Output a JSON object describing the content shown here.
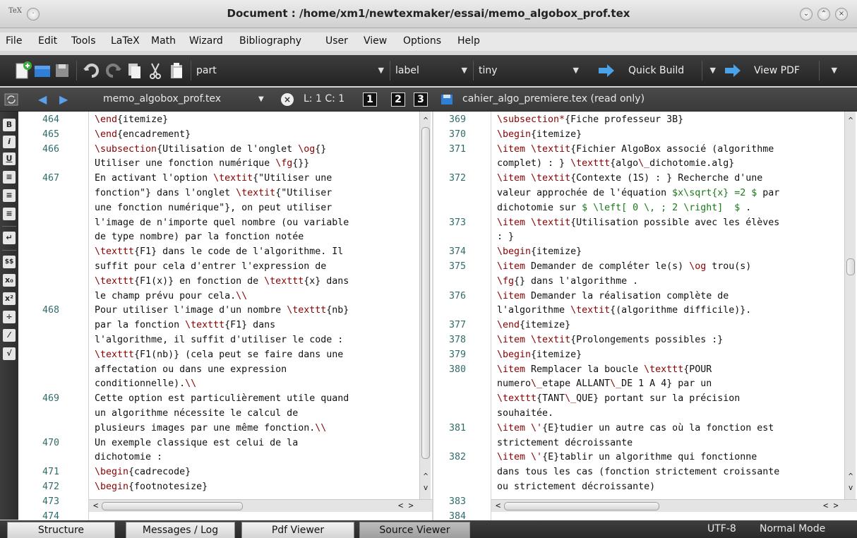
{
  "window": {
    "title": "Document : /home/xm1/newtexmaker/essai/memo_algobox_prof.tex",
    "app_icon": "TeX"
  },
  "menu": [
    "File",
    "Edit",
    "Tools",
    "LaTeX",
    "Math",
    "Wizard",
    "Bibliography",
    "User",
    "View",
    "Options",
    "Help"
  ],
  "toolbar": {
    "combo_part": "part",
    "combo_label": "label",
    "combo_size": "tiny",
    "quick_build": "Quick Build",
    "view_pdf": "View PDF"
  },
  "tabstrip": {
    "left_file": "memo_algobox_prof.tex",
    "cursor": "L: 1 C: 1",
    "views": [
      "1",
      "2",
      "3"
    ],
    "right_file": "cahier_algo_premiere.tex (read only)"
  },
  "left_toolbar": [
    "B",
    "i",
    "U",
    "≡",
    "≡",
    "≡",
    "↵",
    "$$",
    "x₀",
    "x²",
    "÷",
    "⁄",
    "√"
  ],
  "left_editor": {
    "lines": [
      {
        "n": "464",
        "t": "\\end{itemize}"
      },
      {
        "n": "465",
        "t": "\\end{encadrement}"
      },
      {
        "n": "466",
        "t": "\\subsection{Utilisation de l'onglet \\og{}"
      },
      {
        "n": "",
        "t": "Utiliser une fonction numérique \\fg{}}"
      },
      {
        "n": "467",
        "t": "En activant l'option \\textit{\"Utiliser une"
      },
      {
        "n": "",
        "t": "fonction\"} dans l'onglet \\textit{\"Utiliser"
      },
      {
        "n": "",
        "t": "une fonction numérique\"}, on peut utiliser"
      },
      {
        "n": "",
        "t": "l'image de n'importe quel nombre (ou variable"
      },
      {
        "n": "",
        "t": "de type nombre) par la fonction notée"
      },
      {
        "n": "",
        "t": "\\texttt{F1} dans le code de l'algorithme. Il"
      },
      {
        "n": "",
        "t": "suffit pour cela d'entrer l'expression de"
      },
      {
        "n": "",
        "t": "\\texttt{F1(x)} en fonction de \\texttt{x} dans"
      },
      {
        "n": "",
        "t": "le champ prévu pour cela.\\\\"
      },
      {
        "n": "468",
        "t": "Pour utiliser l'image d'un nombre \\texttt{nb}"
      },
      {
        "n": "",
        "t": "par la fonction \\texttt{F1} dans"
      },
      {
        "n": "",
        "t": "l'algorithme, il suffit d'utiliser le code :"
      },
      {
        "n": "",
        "t": "\\texttt{F1(nb)} (cela peut se faire dans une"
      },
      {
        "n": "",
        "t": "affectation ou dans une expression"
      },
      {
        "n": "",
        "t": "conditionnelle).\\\\"
      },
      {
        "n": "469",
        "t": "Cette option est particulièrement utile quand"
      },
      {
        "n": "",
        "t": "un algorithme nécessite le calcul de"
      },
      {
        "n": "",
        "t": "plusieurs images par une même fonction.\\\\"
      },
      {
        "n": "470",
        "t": "Un exemple classique est celui de la"
      },
      {
        "n": "",
        "t": "dichotomie :"
      },
      {
        "n": "471",
        "t": "\\begin{cadrecode}"
      },
      {
        "n": "472",
        "t": "\\begin{footnotesize}"
      },
      {
        "n": "473",
        "t": ""
      },
      {
        "n": "474",
        "t": ""
      }
    ]
  },
  "right_editor": {
    "lines": [
      {
        "n": "369",
        "t": "\\subsection*{Fiche professeur 3B}"
      },
      {
        "n": "370",
        "t": "\\begin{itemize}"
      },
      {
        "n": "371",
        "t": "\\item \\textit{Fichier AlgoBox associé (algorithme"
      },
      {
        "n": "",
        "t": "complet) : } \\texttt{algo\\_dichotomie.alg}"
      },
      {
        "n": "372",
        "t": "\\item \\textit{Contexte (1S) : } Recherche d'une"
      },
      {
        "n": "",
        "t": "valeur approchée de l'équation $x\\sqrt{x} =2 $ par"
      },
      {
        "n": "",
        "t": "dichotomie sur $ \\left[ 0 \\, ; 2 \\right]  $ ."
      },
      {
        "n": "373",
        "t": "\\item \\textit{Utilisation possible avec les élèves"
      },
      {
        "n": "",
        "t": ": }"
      },
      {
        "n": "374",
        "t": "\\begin{itemize}"
      },
      {
        "n": "375",
        "t": "\\item Demander de compléter le(s) \\og trou(s)"
      },
      {
        "n": "",
        "t": "\\fg{} dans l'algorithme ."
      },
      {
        "n": "376",
        "t": "\\item Demander la réalisation complète de"
      },
      {
        "n": "",
        "t": "l'algorithme \\textit{(algorithme difficile)}."
      },
      {
        "n": "377",
        "t": "\\end{itemize}"
      },
      {
        "n": "378",
        "t": "\\item \\textit{Prolongements possibles :}"
      },
      {
        "n": "379",
        "t": "\\begin{itemize}"
      },
      {
        "n": "380",
        "t": "\\item Remplacer la boucle \\texttt{POUR"
      },
      {
        "n": "",
        "t": "numero\\_etape ALLANT\\_DE 1 A 4} par un"
      },
      {
        "n": "",
        "t": "\\texttt{TANT\\_QUE} portant sur la précision"
      },
      {
        "n": "",
        "t": "souhaitée."
      },
      {
        "n": "381",
        "t": "\\item \\'{E}tudier un autre cas où la fonction est"
      },
      {
        "n": "",
        "t": "strictement décroissante"
      },
      {
        "n": "382",
        "t": "\\item \\'{E}tablir un algorithme qui fonctionne"
      },
      {
        "n": "",
        "t": "dans tous les cas (fonction strictement croissante"
      },
      {
        "n": "",
        "t": "ou strictement décroissante)"
      },
      {
        "n": "383",
        "t": ""
      },
      {
        "n": "384",
        "t": ""
      }
    ]
  },
  "bottom_tabs": [
    "Structure",
    "Messages / Log",
    "Pdf Viewer",
    "Source Viewer"
  ],
  "status": {
    "encoding": "UTF-8",
    "mode": "Normal Mode"
  }
}
